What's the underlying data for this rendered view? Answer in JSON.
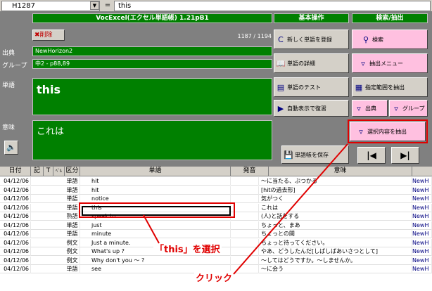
{
  "formula": {
    "cell": "H1287",
    "value": "this",
    "eq": "="
  },
  "title": "VocExcel(エクセル単語帳)  1.21pB1",
  "delete_label": "削除",
  "counter": "1187 / 1194",
  "labels": {
    "source": "出典",
    "group": "グループ",
    "word": "単語",
    "meaning": "意味"
  },
  "source_value": "NewHorizon2",
  "group_value": "中2 - p88,89",
  "word_value": "this",
  "meaning_value": "これは",
  "sections": {
    "basic": "基本操作",
    "search": "検索/抽出"
  },
  "buttons": {
    "register": "新しく単語を登録",
    "search": "検索",
    "detail": "単語の詳細",
    "extract_menu": "抽出メニュー",
    "test": "単語のテスト",
    "extract_range": "指定範囲を抽出",
    "auto_review": "自動表示で復習",
    "by_source": "出典",
    "by_group": "グループ",
    "extract_selected": "選択内容を抽出",
    "save": "単語帳を保存"
  },
  "table": {
    "headers": [
      "日付",
      "記",
      "T",
      "ﾍﾞﾙ",
      "区分",
      "単語",
      "発音",
      "意味"
    ],
    "rows": [
      {
        "date": "04/12/06",
        "type": "単語",
        "word": "hit",
        "meaning": "～に当たる、ぶつかる",
        "src": "NewH"
      },
      {
        "date": "04/12/06",
        "type": "単語",
        "word": "hit",
        "meaning": "[hitの過去形]",
        "src": "NewH"
      },
      {
        "date": "04/12/06",
        "type": "単語",
        "word": "notice",
        "meaning": "気がつく",
        "src": "NewH"
      },
      {
        "date": "04/12/06",
        "type": "単語",
        "word": "this",
        "meaning": "これは",
        "src": "NewH"
      },
      {
        "date": "04/12/06",
        "type": "熟語",
        "word": "speak to",
        "meaning": "(人)と話をする",
        "src": "NewH"
      },
      {
        "date": "04/12/06",
        "type": "単語",
        "word": "just",
        "meaning": "ちょっと、まあ",
        "src": "NewH"
      },
      {
        "date": "04/12/06",
        "type": "単語",
        "word": "minute",
        "meaning": "ちょっとの間",
        "src": "NewH"
      },
      {
        "date": "04/12/06",
        "type": "例文",
        "word": "Just a minute.",
        "meaning": "ちょっと待ってください。",
        "src": "NewH"
      },
      {
        "date": "04/12/06",
        "type": "例文",
        "word": "What's up ?",
        "meaning": "やあ、どうしたんだ[しばしばあいさつとして]",
        "src": "NewH"
      },
      {
        "date": "04/12/06",
        "type": "例文",
        "word": "Why don't you ～ ?",
        "meaning": "～してはどうですか。～しませんか。",
        "src": "NewH"
      },
      {
        "date": "04/12/06",
        "type": "単語",
        "word": "see",
        "meaning": "～に会う",
        "src": "NewH"
      }
    ]
  },
  "callouts": {
    "select": "「this」を選択",
    "click": "クリック"
  },
  "colors": {
    "green": "#008000",
    "annotation_red": "#e00000"
  }
}
